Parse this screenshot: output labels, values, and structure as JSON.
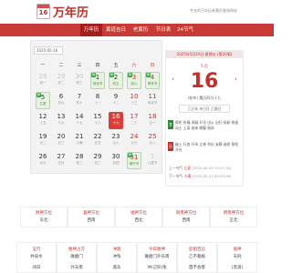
{
  "header": {
    "logo_num": "16",
    "site_name": "万年历",
    "slogan": "专业的万年历老黄历查询网站"
  },
  "nav": {
    "items": [
      {
        "label": "万年历",
        "active": true
      },
      {
        "label": "黄道吉日",
        "active": false
      },
      {
        "label": "老黄历",
        "active": false
      },
      {
        "label": "节日表",
        "active": false
      },
      {
        "label": "24节气",
        "active": false
      }
    ]
  },
  "calendar": {
    "date_input": "2025-05-16",
    "weekdays": [
      "一",
      "二",
      "三",
      "四",
      "五",
      "六",
      "日"
    ],
    "rows": [
      [
        {
          "n": "28",
          "s": "初一",
          "other": true
        },
        {
          "n": "29",
          "s": "初二",
          "other": true
        },
        {
          "n": "30",
          "s": "初三",
          "other": true
        },
        {
          "n": "1",
          "s": "劳动节",
          "badge": "休"
        },
        {
          "n": "2",
          "s": "初五",
          "badge": "休"
        },
        {
          "n": "3",
          "s": "初六",
          "badge": "休"
        },
        {
          "n": "4",
          "s": "青年节",
          "badge": "休"
        }
      ],
      [
        {
          "n": "5",
          "s": "立夏",
          "badge": "休"
        },
        {
          "n": "6",
          "s": "初九"
        },
        {
          "n": "7",
          "s": "初十"
        },
        {
          "n": "8",
          "s": "十一"
        },
        {
          "n": "9",
          "s": "十二"
        },
        {
          "n": "10",
          "s": "十三"
        },
        {
          "n": "11",
          "s": "母亲节"
        }
      ],
      [
        {
          "n": "12",
          "s": "十五"
        },
        {
          "n": "13",
          "s": "十六"
        },
        {
          "n": "14",
          "s": "十七"
        },
        {
          "n": "15",
          "s": "十八"
        },
        {
          "n": "16",
          "s": "十九",
          "today": true
        },
        {
          "n": "17",
          "s": "二十"
        },
        {
          "n": "18",
          "s": "廿一"
        }
      ],
      [
        {
          "n": "19",
          "s": "廿二"
        },
        {
          "n": "20",
          "s": "廿三"
        },
        {
          "n": "21",
          "s": "小满"
        },
        {
          "n": "22",
          "s": "廿五"
        },
        {
          "n": "23",
          "s": "廿六"
        },
        {
          "n": "24",
          "s": "廿七"
        },
        {
          "n": "25",
          "s": "廿八"
        }
      ],
      [
        {
          "n": "26",
          "s": "廿九"
        },
        {
          "n": "27",
          "s": "五月"
        },
        {
          "n": "28",
          "s": "初二"
        },
        {
          "n": "29",
          "s": "初三"
        },
        {
          "n": "30",
          "s": "初四"
        },
        {
          "n": "31",
          "s": "端午节",
          "badge": "休"
        },
        {
          "n": "1",
          "s": "儿童节",
          "other": true
        }
      ]
    ]
  },
  "detail": {
    "head": "2025年5月16日 星期五 (第20周)",
    "month": "5 月",
    "day": "16",
    "lunar": "(蛇年) 農历四月十九",
    "ganzhi": "乙巳年 辛巳月 乙酉日",
    "yi_label": "宜",
    "yi_text": "祭祀 祈福 求嗣 开光 出火 出行 拆卸 修造 动土 上梁 安床 嫁娶 纳采",
    "ji_label": "忌",
    "ji_text": "破土 行丧 开市 立券 作灶 安葬 造桥 祭祀 开仓",
    "prev_term_label": "上一节气",
    "prev_term_name": "立夏",
    "prev_term_date": "(2025-05-05 13:57:10)",
    "next_term_label": "下一节气",
    "next_term_name": "小满",
    "next_term_date": "(2025-05-21 02:54:56)"
  },
  "directions": [
    {
      "title": "财神方位",
      "value": "东北"
    },
    {
      "title": "喜神方位",
      "value": "西南"
    },
    {
      "title": "福神方位",
      "value": "西北"
    },
    {
      "title": "阳贵神方位",
      "value": "西南"
    },
    {
      "title": "阴贵神方位",
      "value": "正北"
    }
  ],
  "info": [
    {
      "title": "五行",
      "lines": [
        "井泉水",
        "",
        "闭日"
      ]
    },
    {
      "title": "胎神占方",
      "lines": [
        "碓磨门",
        "",
        "外东南"
      ]
    },
    {
      "title": "冲煞",
      "lines": [
        "冲兔",
        "",
        "煞东"
      ]
    },
    {
      "title": "今日胎神",
      "lines": [
        "碓磨门外东南",
        "",
        "冲(己卯)兔"
      ]
    },
    {
      "title": "彭祖百忌",
      "lines": [
        "乙不栽植",
        "",
        "酉不会客"
      ]
    },
    {
      "title": "值神",
      "lines": [
        "天刑",
        "",
        "(黑道)"
      ]
    }
  ],
  "colors": {
    "brand_red": "#c4302b",
    "nav_bg": "#c73a35",
    "holiday_green": "#43a047",
    "today_bg": "#d9403a"
  }
}
